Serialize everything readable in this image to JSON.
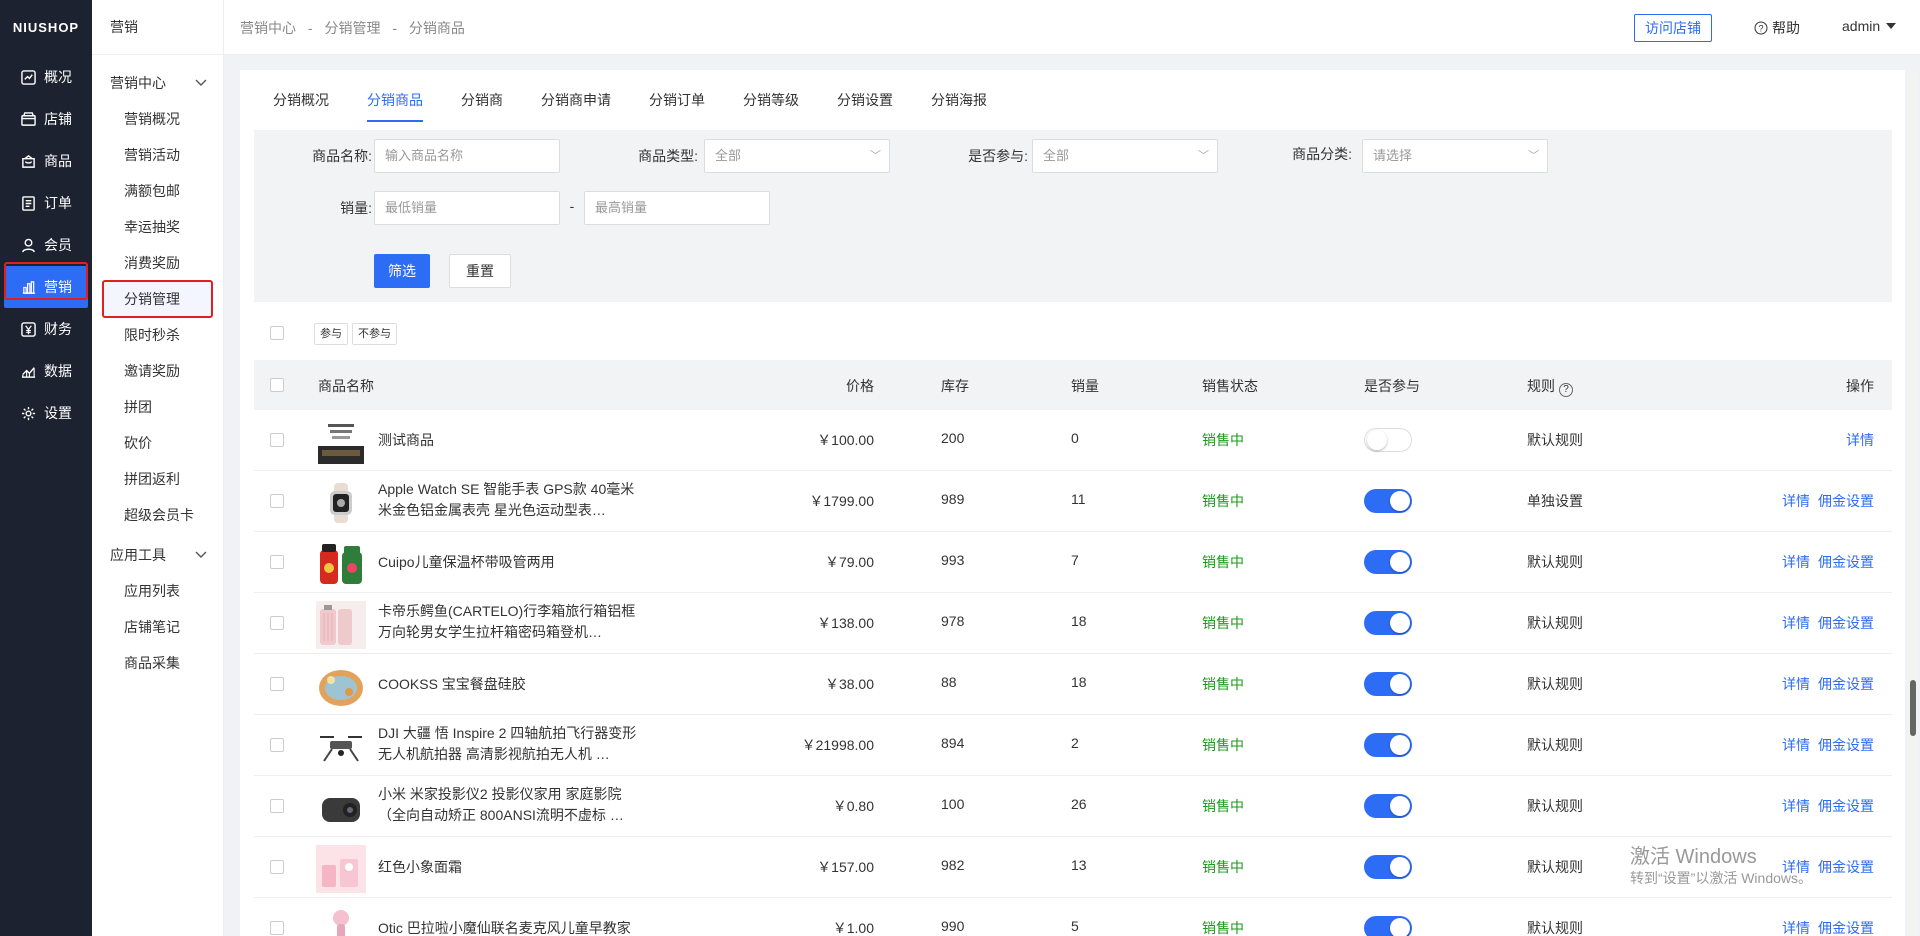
{
  "rail": {
    "logo": "NIUSHOP",
    "items": [
      {
        "label": "概况",
        "icon": "chart-icon"
      },
      {
        "label": "店铺",
        "icon": "store-icon"
      },
      {
        "label": "商品",
        "icon": "bag-icon"
      },
      {
        "label": "订单",
        "icon": "document-icon"
      },
      {
        "label": "会员",
        "icon": "user-icon"
      },
      {
        "label": "营销",
        "icon": "bar-chart-icon"
      },
      {
        "label": "财务",
        "icon": "yen-icon"
      },
      {
        "label": "数据",
        "icon": "data-icon"
      },
      {
        "label": "设置",
        "icon": "gear-icon"
      }
    ],
    "active_index": 5
  },
  "subnav": {
    "title": "营销",
    "group1": "营销中心",
    "items1": [
      "营销概况",
      "营销活动",
      "满额包邮",
      "幸运抽奖",
      "消费奖励",
      "分销管理",
      "限时秒杀",
      "邀请奖励",
      "拼团",
      "砍价",
      "拼团返利",
      "超级会员卡"
    ],
    "group2": "应用工具",
    "items2": [
      "应用列表",
      "店铺笔记",
      "商品采集"
    ]
  },
  "header": {
    "crumbs": [
      "营销中心",
      "-",
      "分销管理",
      "-",
      "分销商品"
    ],
    "visit_label": "访问店铺",
    "help_label": "帮助",
    "user": "admin"
  },
  "tabs": [
    "分销概况",
    "分销商品",
    "分销商",
    "分销商申请",
    "分销订单",
    "分销等级",
    "分销设置",
    "分销海报"
  ],
  "filter": {
    "name_label": "商品名称:",
    "name_placeholder": "输入商品名称",
    "type_label": "商品类型:",
    "type_value": "全部",
    "join_label": "是否参与:",
    "join_value": "全部",
    "cat_label": "商品分类:",
    "cat_value": "请选择",
    "sales_label": "销量:",
    "sales_min": "最低销量",
    "sales_sep": "-",
    "sales_max": "最高销量",
    "submit": "筛选",
    "reset": "重置"
  },
  "batch": {
    "join": "参与",
    "nojoin": "不参与"
  },
  "table": {
    "headers": {
      "name": "商品名称",
      "price": "价格",
      "stock": "库存",
      "sales": "销量",
      "state": "销售状态",
      "join": "是否参与",
      "rule": "规则",
      "op": "操作"
    },
    "rows": [
      {
        "name": "测试商品",
        "price": "￥100.00",
        "stock": "200",
        "sales": "0",
        "state": "销售中",
        "join": false,
        "rule": "默认规则",
        "op1": "详情",
        "op2": ""
      },
      {
        "name": "Apple Watch SE 智能手表 GPS款 40毫米米金色铝金属表壳 星光色运动型表…",
        "price": "￥1799.00",
        "stock": "989",
        "sales": "11",
        "state": "销售中",
        "join": true,
        "rule": "单独设置",
        "op1": "详情",
        "op2": "佣金设置"
      },
      {
        "name": "Cuipo儿童保温杯带吸管两用",
        "price": "￥79.00",
        "stock": "993",
        "sales": "7",
        "state": "销售中",
        "join": true,
        "rule": "默认规则",
        "op1": "详情",
        "op2": "佣金设置"
      },
      {
        "name": "卡帝乐鳄鱼(CARTELO)行李箱旅行箱铝框万向轮男女学生拉杆箱密码箱登机…",
        "price": "￥138.00",
        "stock": "978",
        "sales": "18",
        "state": "销售中",
        "join": true,
        "rule": "默认规则",
        "op1": "详情",
        "op2": "佣金设置"
      },
      {
        "name": "COOKSS 宝宝餐盘硅胶",
        "price": "￥38.00",
        "stock": "88",
        "sales": "18",
        "state": "销售中",
        "join": true,
        "rule": "默认规则",
        "op1": "详情",
        "op2": "佣金设置"
      },
      {
        "name": "DJI 大疆 悟 Inspire 2 四轴航拍飞行器变形无人机航拍器 高清影视航拍无人机 …",
        "price": "￥21998.00",
        "stock": "894",
        "sales": "2",
        "state": "销售中",
        "join": true,
        "rule": "默认规则",
        "op1": "详情",
        "op2": "佣金设置"
      },
      {
        "name": "小米 米家投影仪2 投影仪家用 家庭影院（全向自动矫正 800ANSI流明不虚标 …",
        "price": "￥0.80",
        "stock": "100",
        "sales": "26",
        "state": "销售中",
        "join": true,
        "rule": "默认规则",
        "op1": "详情",
        "op2": "佣金设置"
      },
      {
        "name": "红色小象面霜",
        "price": "￥157.00",
        "stock": "982",
        "sales": "13",
        "state": "销售中",
        "join": true,
        "rule": "默认规则",
        "op1": "详情",
        "op2": "佣金设置"
      },
      {
        "name": "Otic 巴拉啦小魔仙联名麦克风儿童早教家用…",
        "price": "￥1.00",
        "stock": "990",
        "sales": "5",
        "state": "销售中",
        "join": true,
        "rule": "默认规则",
        "op1": "详情",
        "op2": "佣金设置"
      }
    ]
  },
  "watermark": {
    "line1": "激活 Windows",
    "line2": "转到“设置”以激活 Windows。"
  },
  "colors": {
    "accent": "#2d6cf5",
    "rail_bg": "#1d2230",
    "status_green": "#1a9b1a",
    "highlight": "#e02020"
  }
}
